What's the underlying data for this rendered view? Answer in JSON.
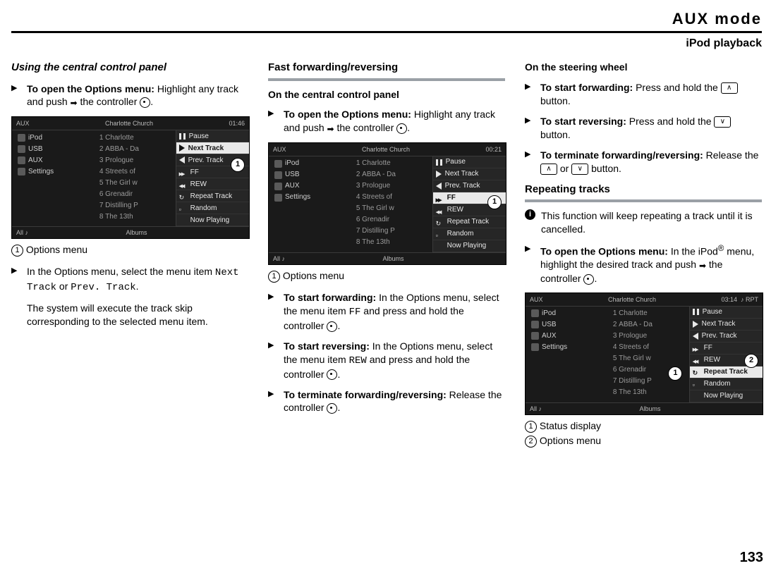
{
  "header": {
    "title": "AUX mode",
    "subtitle": "iPod playback"
  },
  "page_number": "133",
  "col1": {
    "h_using": "Using the central control panel",
    "open_opts_bold": "To open the Options menu:",
    "open_opts_rest": " Highlight any track and push ",
    "open_opts_tail": " the controller ",
    "open_opts_end": ".",
    "cap1": "Options menu",
    "select_item_a": "In the Options menu, select the menu item ",
    "menu_next": "Next Track",
    "or": " or ",
    "menu_prev": "Prev. Track",
    "select_item_b": ".",
    "exec": "The system will execute the track skip corresponding to the selected menu item."
  },
  "col2": {
    "h_ff": "Fast forwarding/reversing",
    "h_on_ccp": "On the central control panel",
    "open_opts_bold": "To open the Options menu:",
    "open_opts_rest": " Highlight any track and push ",
    "open_opts_tail": " the controller ",
    "open_opts_end": ".",
    "cap1": "Options menu",
    "start_fwd_bold": "To start forwarding:",
    "start_fwd_rest": " In the Options menu, select the menu item ",
    "ff_code": "FF",
    "start_fwd_tail": " and press and hold the controller ",
    "start_fwd_end": ".",
    "start_rev_bold": "To start reversing:",
    "start_rev_rest": " In the Options menu, select the menu item ",
    "rew_code": "REW",
    "start_rev_tail": " and press and hold the controller ",
    "start_rev_end": ".",
    "term_bold": "To terminate forwarding/reversing:",
    "term_rest": " Release the controller ",
    "term_end": "."
  },
  "col3": {
    "h_wheel": "On the steering wheel",
    "fwd_bold": "To start forwarding:",
    "fwd_rest": " Press and hold the ",
    "fwd_end": " button.",
    "rev_bold": "To start reversing:",
    "rev_rest": " Press and hold the ",
    "rev_end": " button.",
    "term_bold": "To terminate forwarding/reversing:",
    "term_rest": " Release the ",
    "or": " or ",
    "term_end": " button.",
    "h_repeat": "Repeating tracks",
    "info": "This function will keep repeating a track until it is cancelled.",
    "open_opts_bold": "To open the Options menu:",
    "open_opts_rest": " In the iPod",
    "open_opts_reg": "®",
    "open_opts_rest2": " menu, highlight the desired track and push ",
    "open_opts_tail": " the controller ",
    "open_opts_end": ".",
    "cap1": "Status display",
    "cap2": "Options menu"
  },
  "shot_common": {
    "top_left": "AUX",
    "top_mid": "Charlotte Church",
    "side": [
      "iPod",
      "USB",
      "AUX",
      "Settings"
    ],
    "tracks": [
      "Charlotte",
      "ABBA - Da",
      "Prologue",
      "Streets of",
      "The Girl w",
      "Grenadir",
      "Distilling P",
      "The 13th"
    ],
    "menu": [
      "Pause",
      "Next Track",
      "Prev. Track",
      "FF",
      "REW",
      "Repeat Track",
      "Random",
      "Now Playing"
    ],
    "bot_left": "All ♪",
    "bot_mid": "Albums"
  },
  "shot1": {
    "time": "01:46",
    "hi_index": 1
  },
  "shot2": {
    "time": "00:21",
    "hi_index": 3
  },
  "shot3": {
    "time": "03:14",
    "rpt": "♪ RPT",
    "hi_index": 5
  }
}
